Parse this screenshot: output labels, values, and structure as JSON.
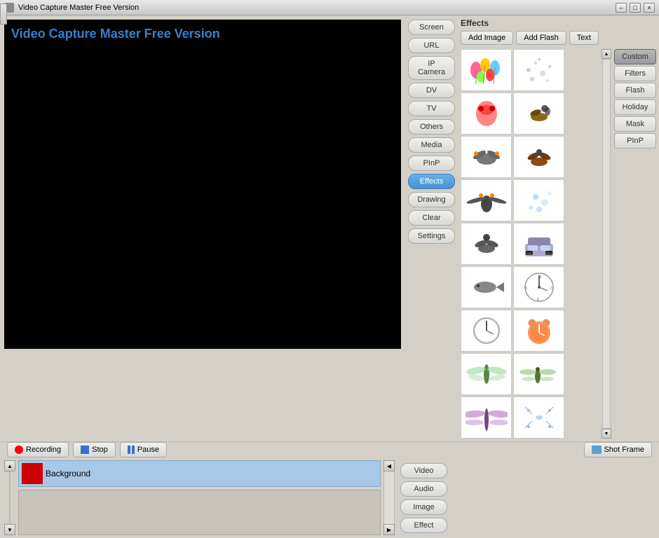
{
  "window": {
    "title": "Video Capture Master Free Version",
    "min_label": "–",
    "max_label": "□",
    "close_label": "×"
  },
  "video": {
    "title_text": "Video Capture Master Free Version"
  },
  "source_buttons": [
    {
      "id": "screen",
      "label": "Screen"
    },
    {
      "id": "url",
      "label": "URL"
    },
    {
      "id": "ip_camera",
      "label": "IP Camera"
    },
    {
      "id": "dv",
      "label": "DV"
    },
    {
      "id": "tv",
      "label": "TV"
    },
    {
      "id": "others",
      "label": "Others"
    },
    {
      "id": "media",
      "label": "Media"
    },
    {
      "id": "pinp",
      "label": "PInP"
    },
    {
      "id": "effects",
      "label": "Effects",
      "active": true
    },
    {
      "id": "drawing",
      "label": "Drawing"
    },
    {
      "id": "clear",
      "label": "Clear"
    },
    {
      "id": "settings",
      "label": "Settings"
    }
  ],
  "effects": {
    "header": "Effects",
    "top_buttons": [
      {
        "id": "add_image",
        "label": "Add Image"
      },
      {
        "id": "add_flash",
        "label": "Add Flash"
      },
      {
        "id": "text",
        "label": "Text"
      }
    ],
    "categories": [
      {
        "id": "custom",
        "label": "Custom",
        "active": true
      },
      {
        "id": "filters",
        "label": "Filters"
      },
      {
        "id": "flash",
        "label": "Flash"
      },
      {
        "id": "holiday",
        "label": "Holiday"
      },
      {
        "id": "mask",
        "label": "Mask"
      },
      {
        "id": "pinp",
        "label": "PInP"
      }
    ]
  },
  "controls": {
    "recording": "Recording",
    "stop": "Stop",
    "pause": "Pause",
    "shot_frame": "Shot Frame"
  },
  "timeline": {
    "track_label": "Background",
    "bottom_buttons": [
      {
        "id": "video",
        "label": "Video"
      },
      {
        "id": "audio",
        "label": "Audio"
      },
      {
        "id": "image",
        "label": "Image"
      },
      {
        "id": "effect",
        "label": "Effect"
      }
    ]
  }
}
